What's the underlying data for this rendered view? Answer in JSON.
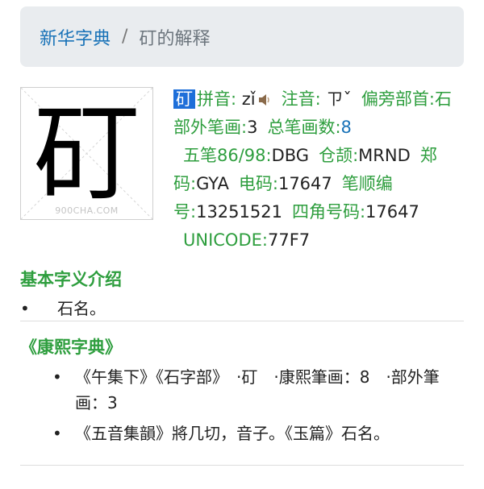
{
  "breadcrumb": {
    "home": "新华字典",
    "separator": "/",
    "current": "矴的解释"
  },
  "image": {
    "character": "矴",
    "watermark": "900CHA.COM"
  },
  "info": {
    "char": "矴",
    "pinyin_label": "拼音:",
    "pinyin_value": "zǐ",
    "zhuyin_label": "注音:",
    "zhuyin_value": "ㄗˇ",
    "radical_label": "偏旁部首:",
    "radical_value": "石",
    "strokes_out_label": "部外笔画:",
    "strokes_out_value": "3",
    "strokes_total_label": "总笔画数:",
    "strokes_total_value": "8",
    "wubi_label": "五笔86/98:",
    "wubi_value": "DBG",
    "cangjie_label": "仓颉:",
    "cangjie_value": "MRND",
    "zhengma_label": "郑码:",
    "zhengma_value": "GYA",
    "dianma_label": "电码:",
    "dianma_value": "17647",
    "bishun_label": "笔顺编号:",
    "bishun_value": "13251521",
    "sijiao_label": "四角号码:",
    "sijiao_value": "17647",
    "unicode_label": "UNICODE:",
    "unicode_value": "77F7"
  },
  "basic": {
    "title": "基本字义介绍",
    "items": [
      "石名。"
    ]
  },
  "kangxi": {
    "title": "《康熙字典》",
    "items": [
      "《午集下》《石字部》　·矴　·康熙筆画：8　·部外筆画：3",
      "《五音集韻》將几切，音子。《玉篇》石名。"
    ]
  },
  "colors": {
    "label_green": "#2e9e3e",
    "link_blue": "#1a73b8",
    "highlight": "#1e6fd9"
  }
}
